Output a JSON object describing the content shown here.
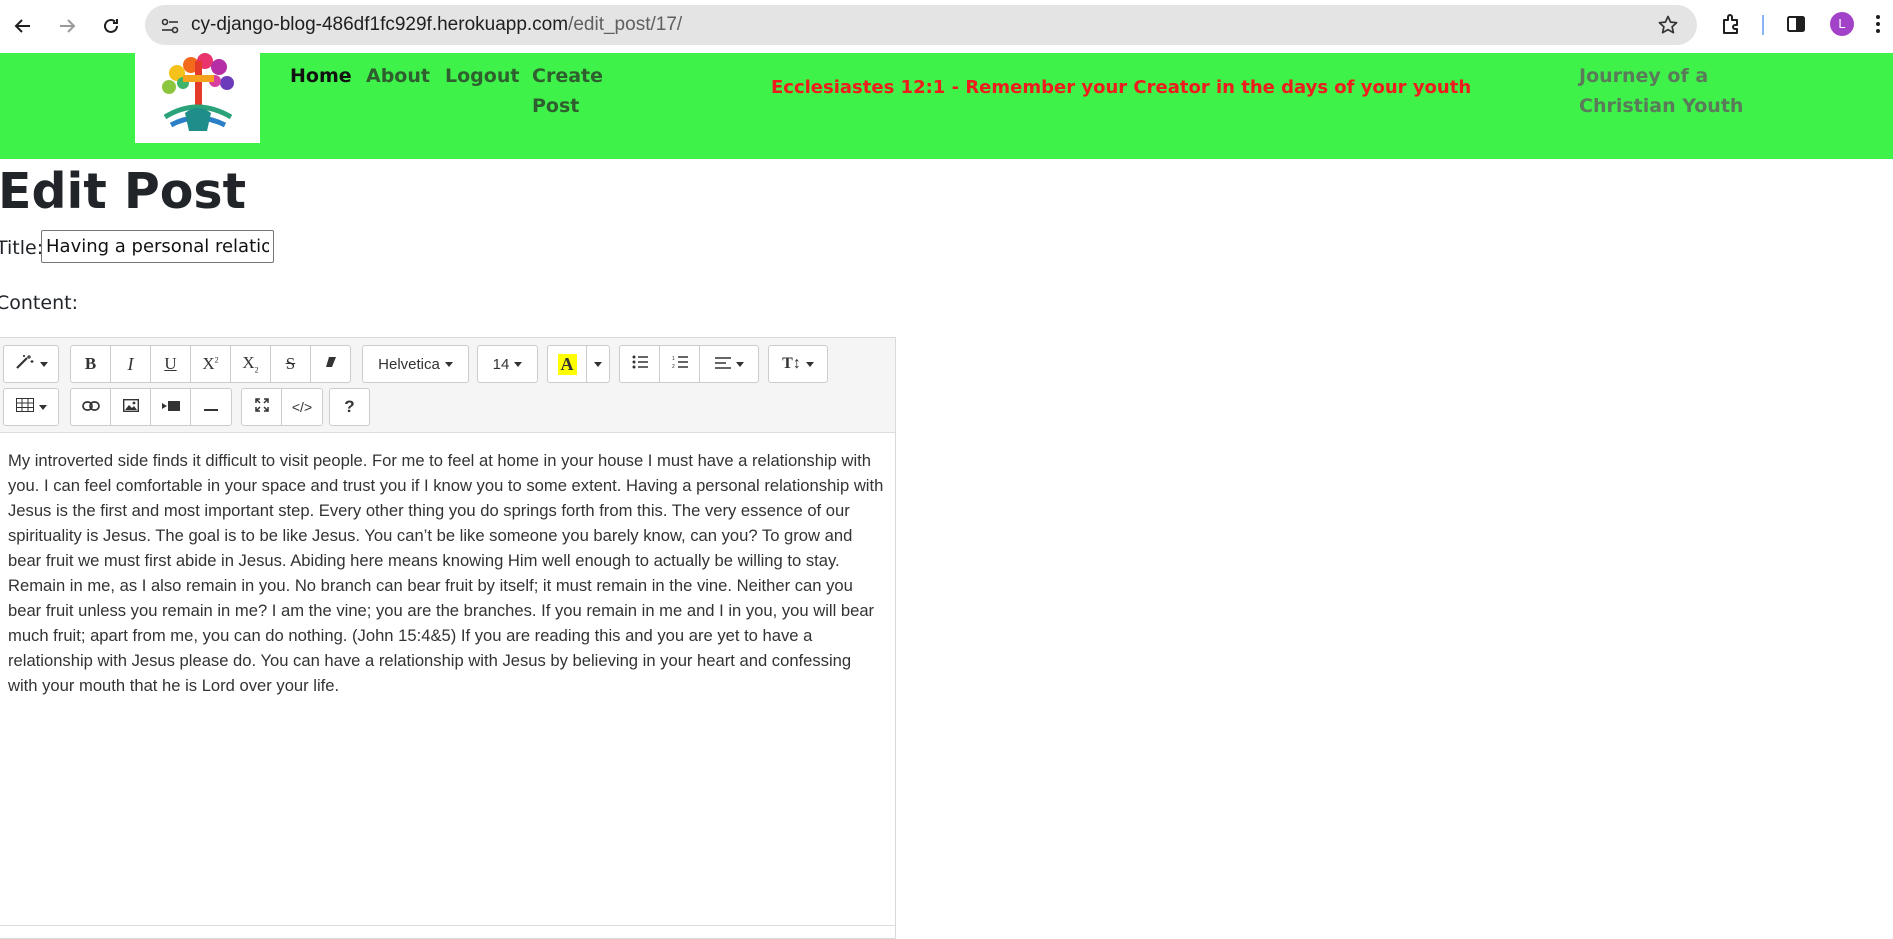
{
  "browser": {
    "url_host": "cy-django-blog-486df1fc929f.herokuapp.com",
    "url_path": "/edit_post/17/",
    "avatar_letter": "L",
    "avatar_color": "#a142c8"
  },
  "site": {
    "nav": {
      "home": "Home",
      "about": "About",
      "logout": "Logout",
      "create_post": "Create Post"
    },
    "verse": "Ecclesiastes 12:1 - Remember your Creator in the days of your youth",
    "brand": "Journey of a Christian Youth",
    "navbar_color": "#3ef24a",
    "verse_color": "#ee1c1c"
  },
  "page": {
    "title": "Edit Post",
    "title_label": "Title:",
    "title_value": "Having a personal relationship with Jesus",
    "content_label": "Content:"
  },
  "editor": {
    "font_name": "Helvetica",
    "font_size": "14",
    "help": "?",
    "content": "My introverted side finds it difficult to visit people. For me to feel at home in your house I must have a relationship with you. I can feel comfortable in your space and trust you if I know you to some extent. Having a personal relationship with Jesus is the first and most important step. Every other thing you do springs forth from this. The very essence of our spirituality is Jesus. The goal is to be like Jesus. You can’t be like someone you barely know, can you? To grow and bear fruit we must first abide in Jesus. Abiding here means knowing Him well enough to actually be willing to stay. Remain in me, as I also remain in you. No branch can bear fruit by itself; it must remain in the vine. Neither can you bear fruit unless you remain in me? I am the vine; you are the branches. If you remain in me and I in you, you will bear much fruit; apart from me, you can do nothing. (John 15:4&5) If you are reading this and you are yet to have a relationship with Jesus please do. You can have a relationship with Jesus by believing in your heart and confessing with your mouth that he is Lord over your life."
  }
}
